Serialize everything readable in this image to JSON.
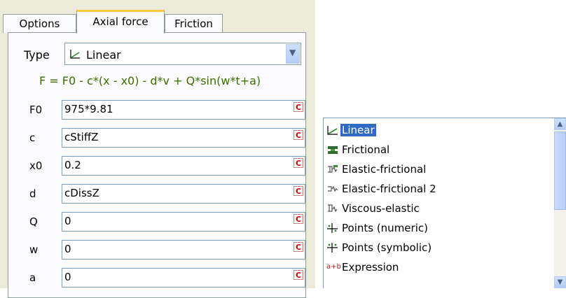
{
  "tabs": [
    {
      "label": "Options"
    },
    {
      "label": "Axial force",
      "active": true
    },
    {
      "label": "Friction"
    }
  ],
  "type_field": {
    "label": "Type",
    "selected": "Linear",
    "icon": "linear-icon"
  },
  "formula": "F = F0  - c*(x - x0) - d*v  + Q*sin(w*t+a)",
  "params": [
    {
      "label": "F0",
      "value": "975*9.81"
    },
    {
      "label": "c",
      "value": "cStiffZ"
    },
    {
      "label": "x0",
      "value": "0.2"
    },
    {
      "label": "d",
      "value": "cDissZ"
    },
    {
      "label": "Q",
      "value": "0"
    },
    {
      "label": "w",
      "value": "0"
    },
    {
      "label": "a",
      "value": "0"
    }
  ],
  "badge_text": "C",
  "dropdown": {
    "items": [
      {
        "label": "Linear",
        "icon": "linear-icon",
        "selected": true
      },
      {
        "label": "Frictional",
        "icon": "frictional-icon"
      },
      {
        "label": "Elastic-frictional",
        "icon": "elastic-frictional-icon"
      },
      {
        "label": "Elastic-frictional 2",
        "icon": "elastic-frictional-2-icon"
      },
      {
        "label": "Viscous-elastic",
        "icon": "viscous-elastic-icon"
      },
      {
        "label": "Points (numeric)",
        "icon": "points-numeric-icon"
      },
      {
        "label": "Points (symbolic)",
        "icon": "points-symbolic-icon"
      },
      {
        "label": "Expression",
        "icon": "expression-icon",
        "icon_text": "a+b"
      }
    ]
  },
  "colors": {
    "formula": "#3a6e00",
    "selection": "#316ac5",
    "badge": "#d00000",
    "active_tab_accent": "#ffc83c"
  }
}
